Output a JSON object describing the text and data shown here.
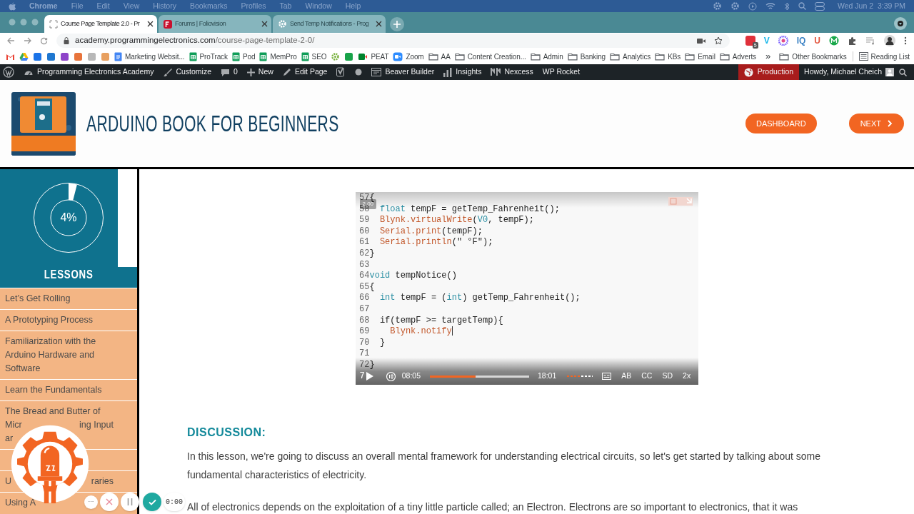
{
  "menu_bar": {
    "app": "Chrome",
    "items": [
      "File",
      "Edit",
      "View",
      "History",
      "Bookmarks",
      "Profiles",
      "Tab",
      "Window",
      "Help"
    ],
    "clock": "Wed Jun 2  3:39 PM"
  },
  "browser_tabs": [
    {
      "title": "Course Page Template 2.0 - Pr",
      "selected": true,
      "kind": "page"
    },
    {
      "title": "Forums | Foliovision",
      "selected": false,
      "kind": "forum"
    },
    {
      "title": "Send Temp Notifications - Prog",
      "selected": false,
      "kind": "gear"
    }
  ],
  "address_bar": {
    "host": "academy.programmingelectronics.com",
    "path": "/course-page-template-2-0/"
  },
  "extensions": [
    {
      "kind": "badge",
      "badge": "5"
    },
    {
      "kind": "letter",
      "label": "V",
      "color": "#1ab7ea"
    },
    {
      "kind": "flower"
    },
    {
      "kind": "letter",
      "label": "IQ",
      "color": "#3b82c4"
    },
    {
      "kind": "letter",
      "label": "U",
      "color": "#e2533b"
    },
    {
      "kind": "circle"
    }
  ],
  "bookmarks": [
    {
      "kind": "mail"
    },
    {
      "kind": "triangle"
    },
    {
      "kind": "app",
      "color": "#1a73e8"
    },
    {
      "kind": "app",
      "color": "#1f77d0"
    },
    {
      "kind": "app",
      "color": "#8e44c9"
    },
    {
      "kind": "app",
      "color": "#e8743b"
    },
    {
      "kind": "app",
      "color": "#b8b8b8"
    },
    {
      "kind": "app",
      "color": "#e8a060"
    },
    {
      "kind": "doc",
      "label": "Marketing Websit..."
    },
    {
      "kind": "sheet",
      "label": "ProTrack"
    },
    {
      "kind": "sheet",
      "label": "Pod"
    },
    {
      "kind": "sheet",
      "label": "MemPro"
    },
    {
      "kind": "sheet",
      "label": "SEO"
    },
    {
      "kind": "gear"
    },
    {
      "kind": "app",
      "color": "#18a34a"
    },
    {
      "kind": "meet",
      "label": "PEAT"
    },
    {
      "kind": "zoom",
      "label": "Zoom"
    },
    {
      "kind": "folder",
      "label": "AA"
    },
    {
      "kind": "folder",
      "label": "Content Creation..."
    },
    {
      "kind": "folder",
      "label": "Admin"
    },
    {
      "kind": "folder",
      "label": "Banking"
    },
    {
      "kind": "folder",
      "label": "Analytics"
    },
    {
      "kind": "folder",
      "label": "KBs"
    },
    {
      "kind": "folder",
      "label": "Email"
    },
    {
      "kind": "folder",
      "label": "Adverts"
    }
  ],
  "bookmarks_more": "»",
  "bookmarks_right": [
    {
      "kind": "folder",
      "label": "Other Bookmarks"
    },
    {
      "kind": "list",
      "label": "Reading List"
    }
  ],
  "admin_bar": {
    "left": [
      {
        "kind": "wp"
      },
      {
        "kind": "dashboard",
        "label": "Programming Electronics Academy"
      },
      {
        "kind": "brush",
        "label": "Customize"
      },
      {
        "kind": "comment",
        "label": "0"
      },
      {
        "kind": "plus",
        "label": "New"
      },
      {
        "kind": "pencil",
        "label": "Edit Page"
      },
      {
        "kind": "yoast"
      },
      {
        "kind": "dot"
      },
      {
        "kind": "builder",
        "label": "Beaver Builder"
      },
      {
        "kind": "bars",
        "label": "Insights"
      },
      {
        "kind": "nexcess",
        "label": "Nexcess"
      },
      {
        "label": "WP Rocket"
      }
    ],
    "environment": "Production",
    "greeting": "Howdy, Michael Cheich"
  },
  "header": {
    "title": "ARDUINO BOOK FOR BEGINNERS",
    "buttons": [
      {
        "label": "DASHBOARD",
        "kind": "plain"
      },
      {
        "label": "NEXT",
        "kind": "next"
      }
    ]
  },
  "progress": {
    "level": 0.04,
    "label": "4%"
  },
  "lessons_heading": "LESSONS",
  "lessons": [
    {
      "kind": "title",
      "title": "Let’s Get Rolling"
    },
    {
      "kind": "title",
      "title": "A Prototyping Process"
    },
    {
      "kind": "title",
      "title": "Familiarization with the Arduino Hardware and Software"
    },
    {
      "kind": "title",
      "title": "Learn the Fundamentals"
    },
    {
      "kind": "covered",
      "fragments": [
        [
          "The Bread and Butter of"
        ],
        [
          "Micr",
          "ing Input"
        ],
        [
          "ar"
        ]
      ]
    },
    {
      "kind": "covered"
    },
    {
      "kind": "covered",
      "fragments": [
        [
          "U",
          "raries"
        ]
      ]
    },
    {
      "kind": "covered",
      "fragments": [
        [
          "Using A"
        ]
      ]
    }
  ],
  "video": {
    "speed_badge": "2.00",
    "code": [
      {
        "num": "57",
        "tokens": [
          {
            "kind": "plain",
            "text": "{"
          }
        ]
      },
      {
        "num": "58",
        "tokens": [
          {
            "kind": "keyword",
            "text": "  float"
          },
          {
            "kind": "plain",
            "text": " tempF = getTemp_Fahrenheit();"
          }
        ]
      },
      {
        "num": "59",
        "tokens": [
          {
            "kind": "function",
            "text": "  Blynk.virtualWrite"
          },
          {
            "kind": "plain",
            "text": "("
          },
          {
            "kind": "keyword",
            "text": "V0"
          },
          {
            "kind": "plain",
            "text": ", tempF);"
          }
        ]
      },
      {
        "num": "60",
        "tokens": [
          {
            "kind": "function",
            "text": "  Serial.print"
          },
          {
            "kind": "plain",
            "text": "(tempF);"
          }
        ]
      },
      {
        "num": "61",
        "tokens": [
          {
            "kind": "function",
            "text": "  Serial.println"
          },
          {
            "kind": "plain",
            "text": "(\" °F\");"
          }
        ]
      },
      {
        "num": "62",
        "tokens": [
          {
            "kind": "plain",
            "text": "}"
          }
        ]
      },
      {
        "num": "63"
      },
      {
        "num": "64",
        "tokens": [
          {
            "kind": "keyword",
            "text": "void"
          },
          {
            "kind": "plain",
            "text": " tempNotice()"
          }
        ]
      },
      {
        "num": "65",
        "tokens": [
          {
            "kind": "plain",
            "text": "{"
          }
        ]
      },
      {
        "num": "66",
        "tokens": [
          {
            "kind": "keyword",
            "text": "  int"
          },
          {
            "kind": "plain",
            "text": " tempF = ("
          },
          {
            "kind": "keyword",
            "text": "int"
          },
          {
            "kind": "plain",
            "text": ") getTemp_Fahrenheit();"
          }
        ]
      },
      {
        "num": "67"
      },
      {
        "num": "68",
        "tokens": [
          {
            "kind": "plain",
            "text": "  if(tempF >= targetTemp){"
          }
        ]
      },
      {
        "num": "69",
        "tokens": [
          {
            "kind": "function",
            "text": "    Blynk.notify"
          }
        ],
        "cursor": true
      },
      {
        "num": "70",
        "tokens": [
          {
            "kind": "plain",
            "text": "  }"
          }
        ]
      },
      {
        "num": "71"
      },
      {
        "num": "72",
        "tokens": [
          {
            "kind": "plain",
            "text": "}"
          }
        ]
      }
    ],
    "controls": {
      "line_stub": "7",
      "elapsed": "08:05",
      "level": 0.46,
      "duration": "18:01",
      "volume": {
        "level": 0.55
      },
      "options": [
        "AB",
        "CC",
        "SD",
        "2x"
      ]
    }
  },
  "discussion": {
    "heading": "DISCUSSION:",
    "paragraphs": [
      "In this lesson, we're going to discuss an overall mental framework for understanding electrical circuits, so let's get started by talking about some fundamental characteristics of electricity.",
      "All of electronics depends on the exploitation of a tiny little particle called; an Electron. Electrons are so important to electronics, that it was"
    ]
  },
  "recorder": {
    "timer": "0:00",
    "more": "···"
  }
}
